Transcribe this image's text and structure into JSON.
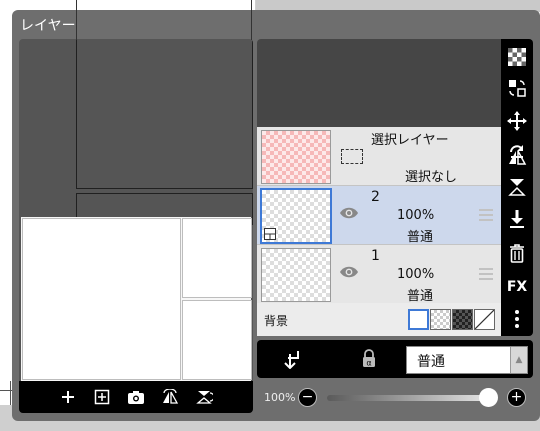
{
  "window": {
    "title": "レイヤー"
  },
  "layers": [
    {
      "kind": "selection",
      "title": "選択レイヤー",
      "status": "選択なし"
    },
    {
      "kind": "layer",
      "number": "2",
      "opacity": "100%",
      "blend": "普通",
      "selected": true
    },
    {
      "kind": "layer",
      "number": "1",
      "opacity": "100%",
      "blend": "普通",
      "selected": false
    }
  ],
  "background": {
    "label": "背景",
    "options": [
      "white",
      "light-checker",
      "dark-checker",
      "none"
    ],
    "selected": "white"
  },
  "preview_toolbar": {
    "icons": [
      "plus-icon",
      "add-page-icon",
      "camera-icon",
      "flip-horizontal-icon",
      "flip-vertical-icon"
    ]
  },
  "side_toolbar": {
    "icons": [
      "transparency-icon",
      "layer-swap-icon",
      "move-icon",
      "rotate-icon",
      "flip-horizontal-icon",
      "flip-vertical-icon",
      "merge-down-icon",
      "trash-icon",
      "fx-icon",
      "more-icon"
    ],
    "fx_label": "FX"
  },
  "blend_bar": {
    "mode": "普通",
    "icons": [
      "clip-arrow-icon",
      "alpha-lock-icon"
    ]
  },
  "opacity_slider": {
    "label": "100%",
    "value": 1.0
  },
  "colors": {
    "accent": "#3e79d6",
    "selected_row": "#cdd8ec",
    "panel": "#6e6e6e",
    "toolbar": "#000000"
  }
}
